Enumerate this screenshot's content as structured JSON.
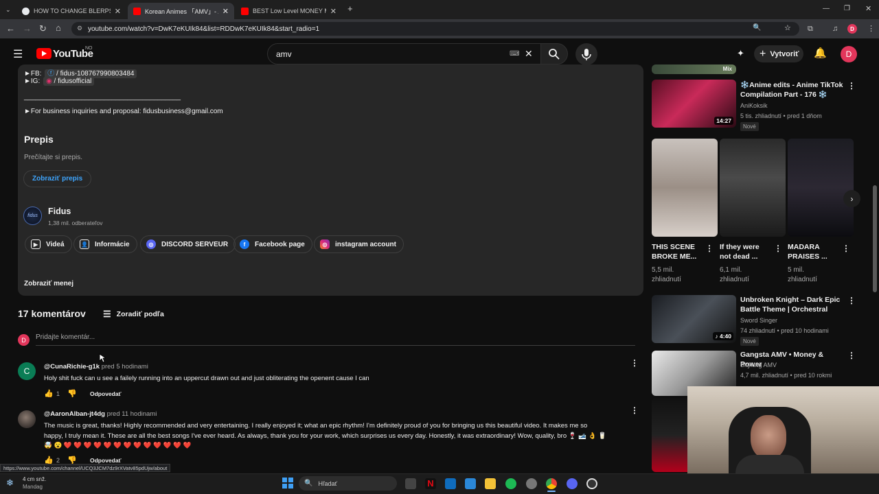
{
  "browser": {
    "tabs": [
      {
        "title": "HOW TO CHANGE BLERPS FOR",
        "favicon_color": "#e8eaed"
      },
      {
        "title": "Korean Animes 「AMV」- All Bur",
        "favicon_color": "#ff0000"
      },
      {
        "title": "BEST Low Level MONEY MAKEI",
        "favicon_color": "#ff0000"
      }
    ],
    "url": "youtube.com/watch?v=DwK7eKUIk84&list=RDDwK7eKUIk84&start_radio=1",
    "profile_initial": "D"
  },
  "youtube": {
    "logo_text": "YouTube",
    "region": "NO",
    "search_value": "amv",
    "create_label": "Vytvoriť",
    "avatar_initial": "D"
  },
  "description": {
    "fb_line": "►FB:",
    "fb_link": "/ fidus-108767990803484",
    "ig_line": "►IG:",
    "ig_link": "/ fidusofficial",
    "divider": "_________________________________________",
    "business": "►For business inquiries and proposal: fidusbusiness@gmail.com",
    "transcript_title": "Prepis",
    "transcript_sub": "Prečítajte si prepis.",
    "transcript_button": "Zobraziť prepis",
    "channel_name": "Fidus",
    "channel_subs": "1,38 mil. odberateľov",
    "buttons": [
      "Videá",
      "Informácie",
      "DISCORD SERVEUR",
      "Facebook page",
      "instagram account"
    ],
    "show_less": "Zobraziť menej"
  },
  "comments": {
    "count_label": "17 komentárov",
    "sort_label": "Zoradiť podľa",
    "add_placeholder": "Pridajte komentár...",
    "user_initial": "D",
    "items": [
      {
        "author": "@CunaRichie-g1k",
        "time": "pred 5 hodinami",
        "avatar_initial": "C",
        "text": "Holy shit fuck can u see a failely running into an uppercut drawn out and just obliterating the openent cause I can",
        "likes": "1",
        "reply": "Odpovedať"
      },
      {
        "author": "@AaronAlban-jt4dg",
        "time": "pred 11 hodinami",
        "avatar_initial": "",
        "text1": "The music is great, thanks! Highly recommended and very entertaining. I really enjoyed it; what an epic rhythm! I'm definitely proud of you for bringing us this beautiful video. It makes me so",
        "text2": "happy, I truly mean it. These are all the best songs I've ever heard. As always, thank you for your work, which surprises us every day. Honestly, it was extraordinary! Wow, quality, bro 🍷 🎿 👌 🥛",
        "text3": "🤯 😮 ❤️ ❤️ ❤️ ❤️ ❤️ ❤️ ❤️ ❤️ ❤️ ❤️ ❤️ ❤️ ❤️",
        "likes": "2",
        "reply": "Odpovedať"
      }
    ]
  },
  "sidebar": {
    "mix_badge": "Mix",
    "videos": [
      {
        "title": "❄️Anime edits - Anime TikTok Compilation Part - 176 ❄️",
        "channel": "AniKoksik",
        "stats": "5 tis. zhliadnutí • pred 1 dňom",
        "duration": "14:27",
        "badge": "Nové"
      },
      {
        "title": "Unbroken Knight – Dark Epic Battle Theme | Orchestral Bos...",
        "channel": "Sword Singer",
        "stats": "74 zhliadnutí • pred 10 hodinami",
        "duration": "4:40",
        "badge": "Nové"
      },
      {
        "title": "Gangsta AMV • Money & Power",
        "channel": "Skyking AMV",
        "stats": "4,7 mil. zhliadnutí • pred 10 rokmi"
      }
    ],
    "shorts": [
      {
        "title1": "THIS SCENE",
        "title2": "BROKE ME...",
        "views1": "5,5 mil.",
        "views2": "zhliadnutí"
      },
      {
        "title1": "If they were",
        "title2": "not dead ...",
        "views1": "6,1 mil.",
        "views2": "zhliadnutí"
      },
      {
        "title1": "MADARA",
        "title2": "PRAISES ...",
        "views1": "5 mil.",
        "views2": "zhliadnutí"
      }
    ]
  },
  "statusbar": {
    "url": "https://www.youtube.com/channel/UCQ3JCM7dz9rXVatv85pdUjw/about"
  },
  "taskbar": {
    "weather_temp": "4 cm snž.",
    "weather_day": "Mandag",
    "search_placeholder": "Hľadať"
  },
  "colors": {
    "accent": "#3ea6ff",
    "brand": "#ff0000",
    "avatar": "#e2365b"
  }
}
